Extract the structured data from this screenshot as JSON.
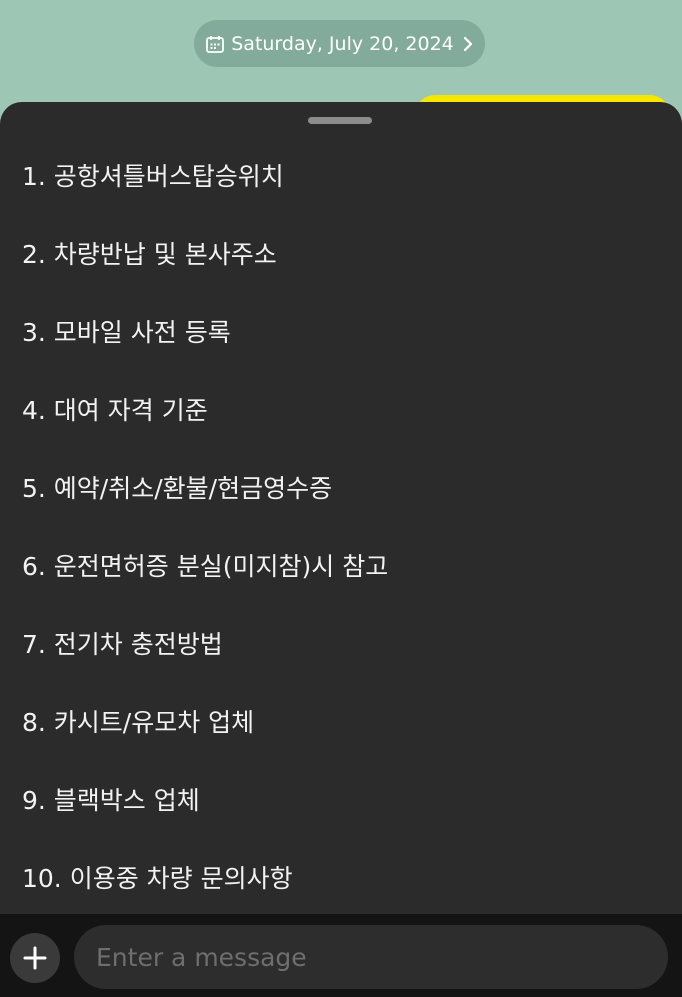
{
  "header": {
    "date_label": "Saturday, July 20, 2024",
    "date_icon": "calendar-icon",
    "chevron_icon": "chevron-right-icon"
  },
  "menu": {
    "items": [
      {
        "label": "1. 공항셔틀버스탑승위치"
      },
      {
        "label": "2. 차량반납 및 본사주소"
      },
      {
        "label": "3. 모바일 사전 등록"
      },
      {
        "label": "4. 대여 자격 기준"
      },
      {
        "label": "5. 예약/취소/환불/현금영수증"
      },
      {
        "label": "6. 운전면허증 분실(미지참)시 참고"
      },
      {
        "label": "7. 전기차 충전방법"
      },
      {
        "label": "8. 카시트/유모차 업체"
      },
      {
        "label": "9. 블랙박스 업체"
      },
      {
        "label": "10. 이용중 차량 문의사항"
      }
    ]
  },
  "composer": {
    "add_icon": "plus-icon",
    "placeholder": "Enter a message",
    "value": ""
  },
  "colors": {
    "chat_background": "#9ec6b5",
    "sheet_background": "#2b2b2b",
    "bottom_bar": "#141414",
    "accent_yellow": "#f7e600"
  }
}
